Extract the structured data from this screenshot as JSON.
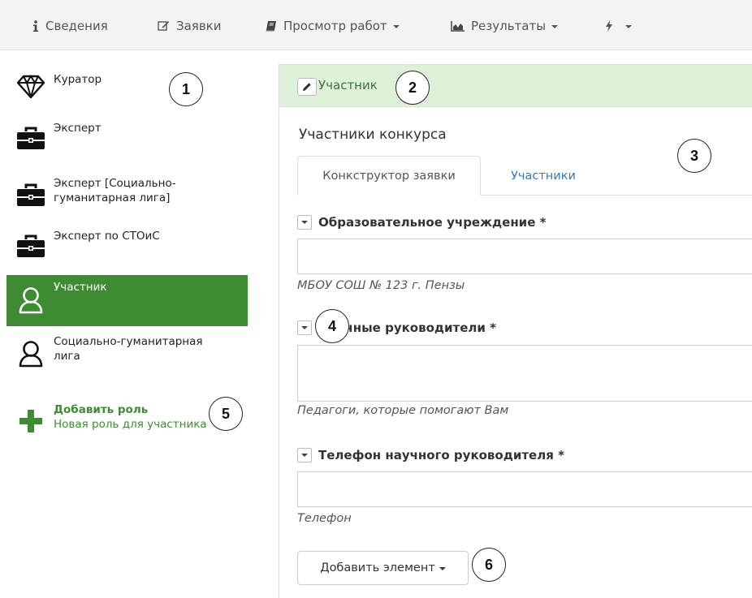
{
  "topnav": {
    "items": [
      {
        "label": "Сведения",
        "icon": "info-icon",
        "dropdown": false
      },
      {
        "label": "Заявки",
        "icon": "edit-icon",
        "dropdown": false
      },
      {
        "label": "Просмотр работ",
        "icon": "book-icon",
        "dropdown": true
      },
      {
        "label": "Результаты",
        "icon": "area-chart-icon",
        "dropdown": true
      },
      {
        "label": "",
        "icon": "bolt-icon",
        "dropdown": true
      }
    ]
  },
  "sidebar": {
    "roles": [
      {
        "label": "Куратор",
        "icon": "diamond-icon",
        "active": false
      },
      {
        "label": "Эксперт",
        "icon": "briefcase-icon",
        "active": false
      },
      {
        "label": "Эксперт [Социально-гуманитарная лига]",
        "icon": "briefcase-icon",
        "active": false
      },
      {
        "label": "Эксперт по СТОиС",
        "icon": "briefcase-icon",
        "active": false
      },
      {
        "label": "Участник",
        "icon": "user-icon",
        "active": true
      },
      {
        "label": "Социально-гуманитарная лига",
        "icon": "user-icon",
        "active": false
      }
    ],
    "add_role": {
      "title": "Добавить роль",
      "subtitle": "Новая роль для участника",
      "icon": "plus-icon"
    }
  },
  "panel": {
    "heading": "Участник",
    "section_title": "Участники конкурса",
    "tabs": [
      {
        "label": "Конкструктор заявки",
        "active": true
      },
      {
        "label": "Участники",
        "active": false
      }
    ],
    "fields": [
      {
        "label": "Образовательное учреждение *",
        "value": "",
        "hint": "МБОУ СОШ № 123 г. Пензы"
      },
      {
        "label": "Научные руководители *",
        "value": "",
        "hint": "Педагоги, которые помогают Вам"
      },
      {
        "label": "Телефон научного руководителя *",
        "value": "",
        "hint": "Телефон"
      }
    ],
    "add_element_label": "Добавить элемент"
  },
  "callouts": [
    "1",
    "2",
    "3",
    "4",
    "5",
    "6"
  ],
  "colors": {
    "active_role_bg": "#3f8b34",
    "panel_heading_bg": "#dff0d8",
    "panel_heading_text": "#3c763d",
    "link": "#337ab7",
    "add_role": "#3f8b34"
  }
}
